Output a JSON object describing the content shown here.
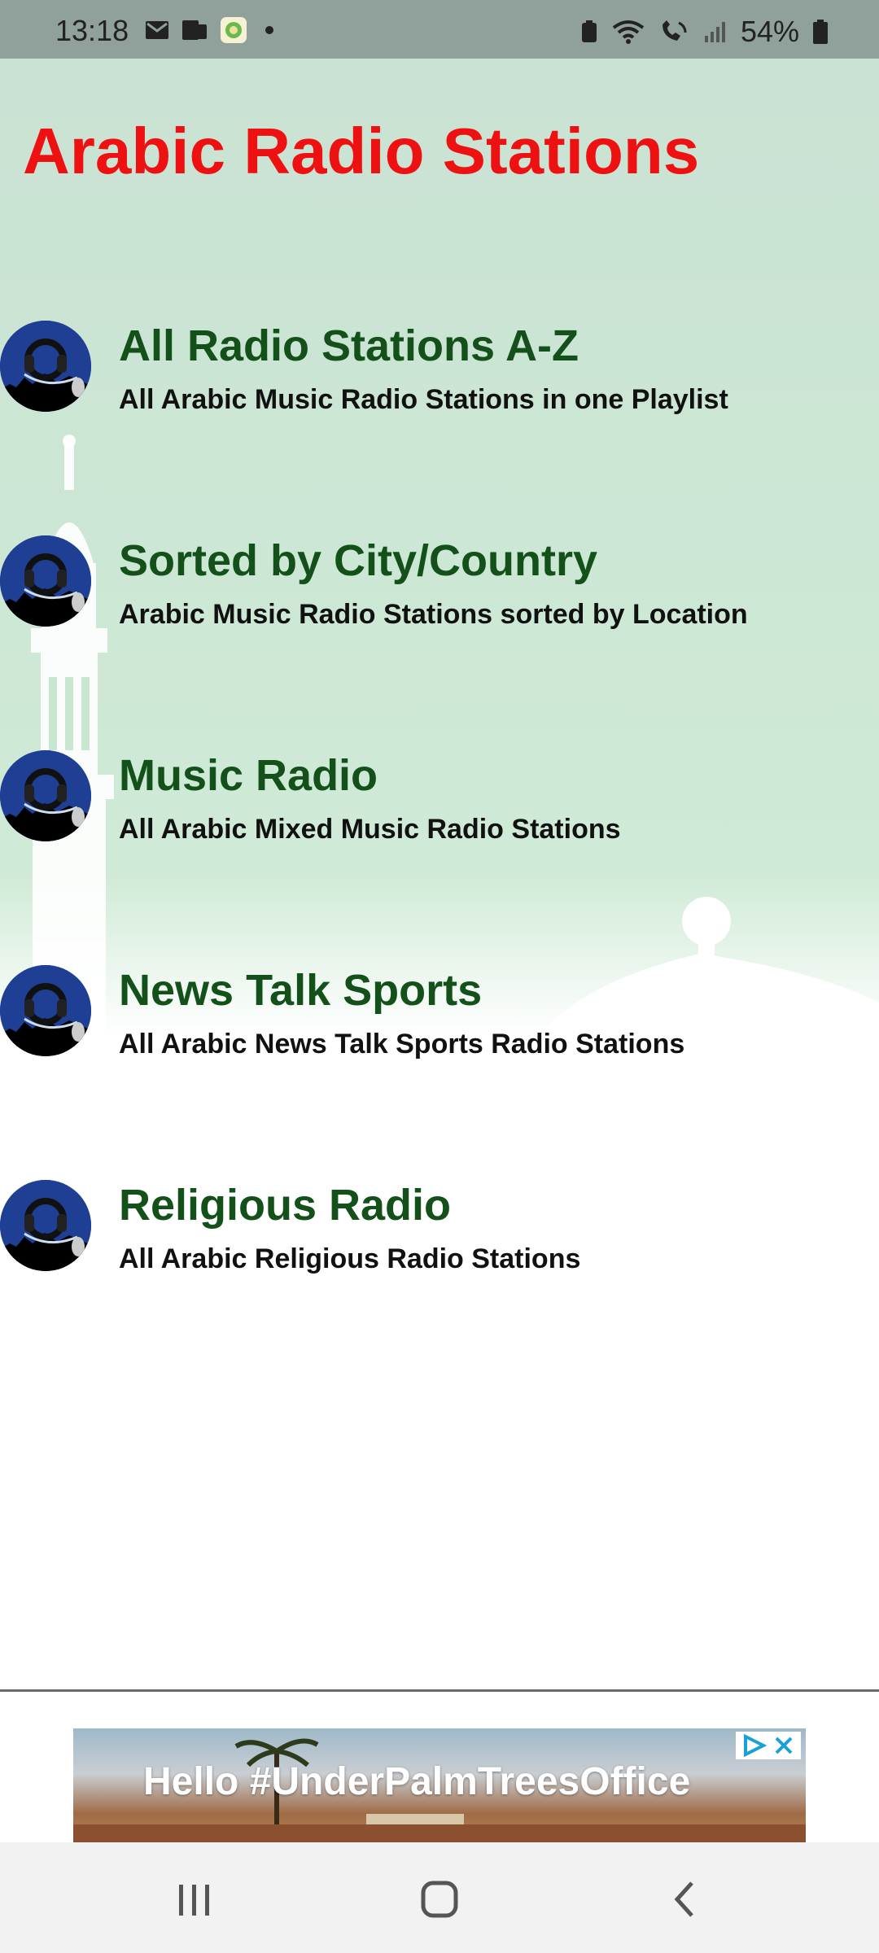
{
  "status_bar": {
    "time": "13:18",
    "battery": "54%",
    "left_icons": [
      "mail-icon",
      "sim-icon",
      "app-icon",
      "dot-icon"
    ],
    "right_icons": [
      "battery-saver-icon",
      "wifi-icon",
      "wifi-calling-icon",
      "signal-icon",
      "battery-icon"
    ]
  },
  "header": {
    "title": "Arabic Radio Stations"
  },
  "items": [
    {
      "title": "All Radio Stations A-Z",
      "subtitle": "All Arabic Music Radio Stations in one Playlist"
    },
    {
      "title": "Sorted by City/Country",
      "subtitle": "Arabic Music Radio Stations sorted by Location"
    },
    {
      "title": "Music Radio",
      "subtitle": "All Arabic Mixed Music Radio Stations"
    },
    {
      "title": "News Talk Sports",
      "subtitle": "All Arabic News Talk Sports Radio Stations"
    },
    {
      "title": "Religious Radio",
      "subtitle": "All Arabic Religious Radio Stations"
    }
  ],
  "ad": {
    "text": "Hello #UnderPalmTreesOffice"
  },
  "nav": [
    "recent-apps-icon",
    "home-icon",
    "back-icon"
  ],
  "colors": {
    "title": "#ee1111",
    "item_title": "#14501a",
    "status_bar": "#8fa19a"
  }
}
